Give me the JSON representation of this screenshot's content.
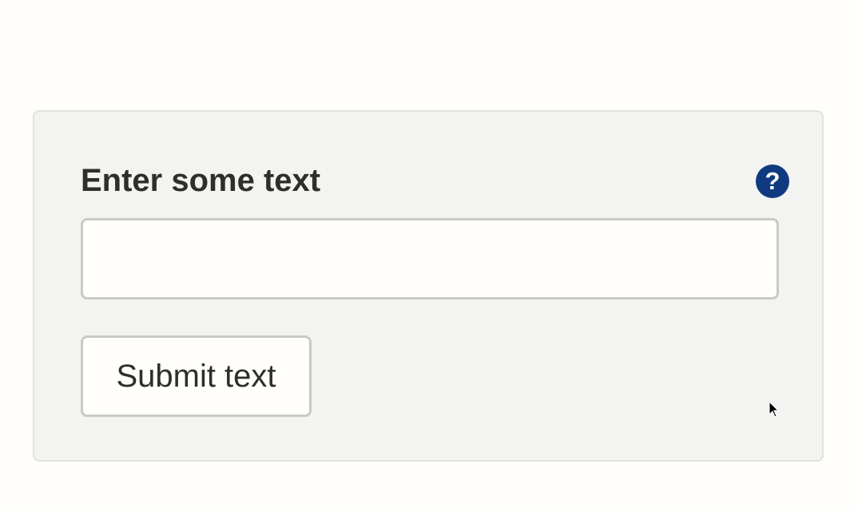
{
  "form": {
    "label": "Enter some text",
    "help_icon": "question-circle-icon",
    "help_glyph": "?",
    "input_value": "",
    "input_placeholder": "",
    "submit_label": "Submit text"
  },
  "colors": {
    "help_icon": "#0f3a7f",
    "panel_background": "#f3f3f1",
    "text": "#2f2e2b"
  }
}
